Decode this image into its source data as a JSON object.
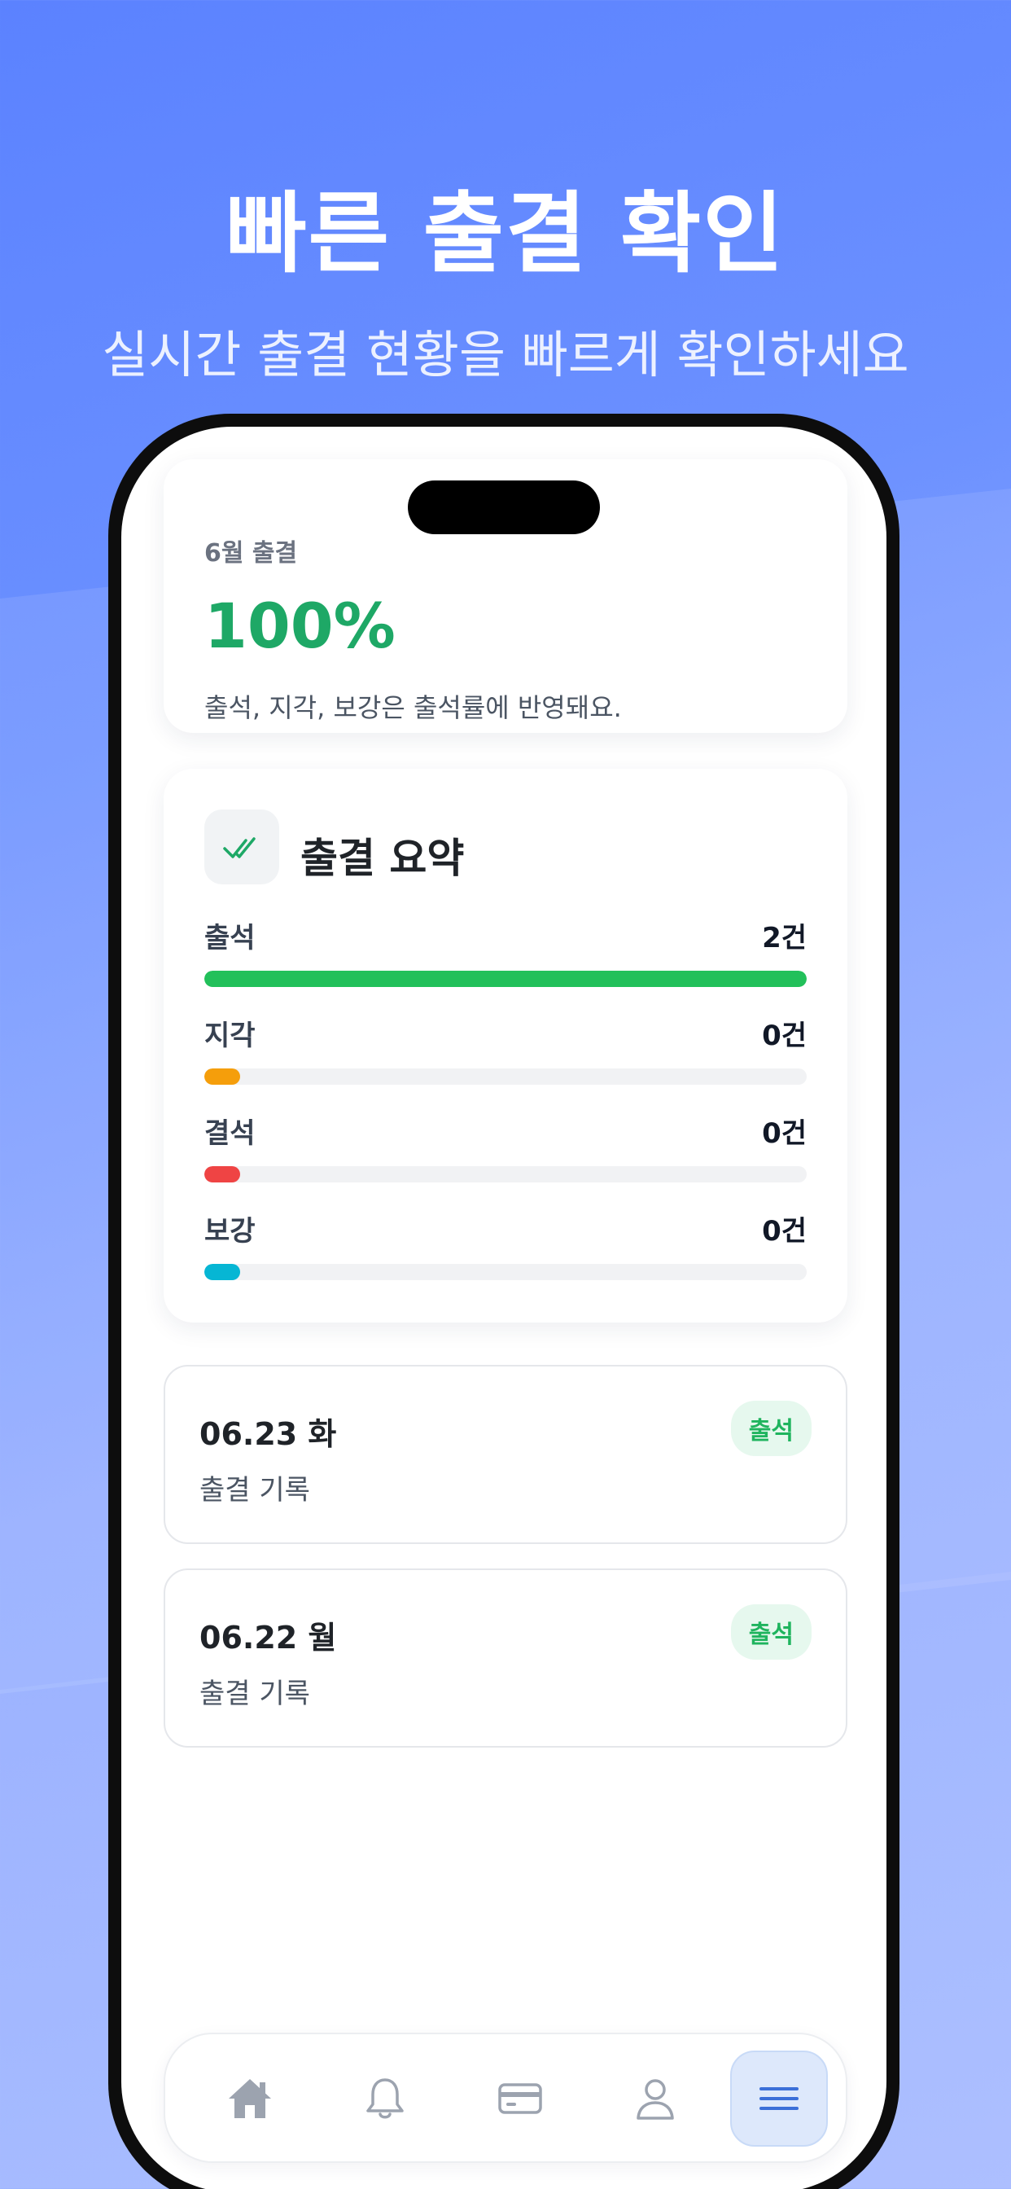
{
  "header": {
    "title": "빠른 출결 확인",
    "subtitle": "실시간 출결 현황을 빠르게 확인하세요"
  },
  "rate_card": {
    "label": "6월 출결",
    "value": "100%",
    "note": "출석, 지각, 보강은 출석률에 반영돼요."
  },
  "summary": {
    "title": "출결 요약",
    "icon": "double-check-icon",
    "rows": [
      {
        "label": "출석",
        "count": "2건",
        "fraction": 1.0,
        "color": "#22c05a"
      },
      {
        "label": "지각",
        "count": "0건",
        "fraction": 0.0,
        "color": "#f59e0b"
      },
      {
        "label": "결석",
        "count": "0건",
        "fraction": 0.0,
        "color": "#ef4444"
      },
      {
        "label": "보강",
        "count": "0건",
        "fraction": 0.0,
        "color": "#06b6d4"
      }
    ]
  },
  "records": [
    {
      "date": "06.23 화",
      "desc": "출결 기록",
      "status": "출석"
    },
    {
      "date": "06.22 월",
      "desc": "출결 기록",
      "status": "출석"
    }
  ],
  "nav": {
    "items": [
      {
        "icon": "home-icon",
        "active": false
      },
      {
        "icon": "bell-icon",
        "active": false
      },
      {
        "icon": "card-icon",
        "active": false
      },
      {
        "icon": "user-icon",
        "active": false
      },
      {
        "icon": "menu-icon",
        "active": true
      }
    ]
  },
  "colors": {
    "accent": "#1ea866",
    "nav_active": "#3b6fd8",
    "nav_inactive": "#9ca3af"
  }
}
